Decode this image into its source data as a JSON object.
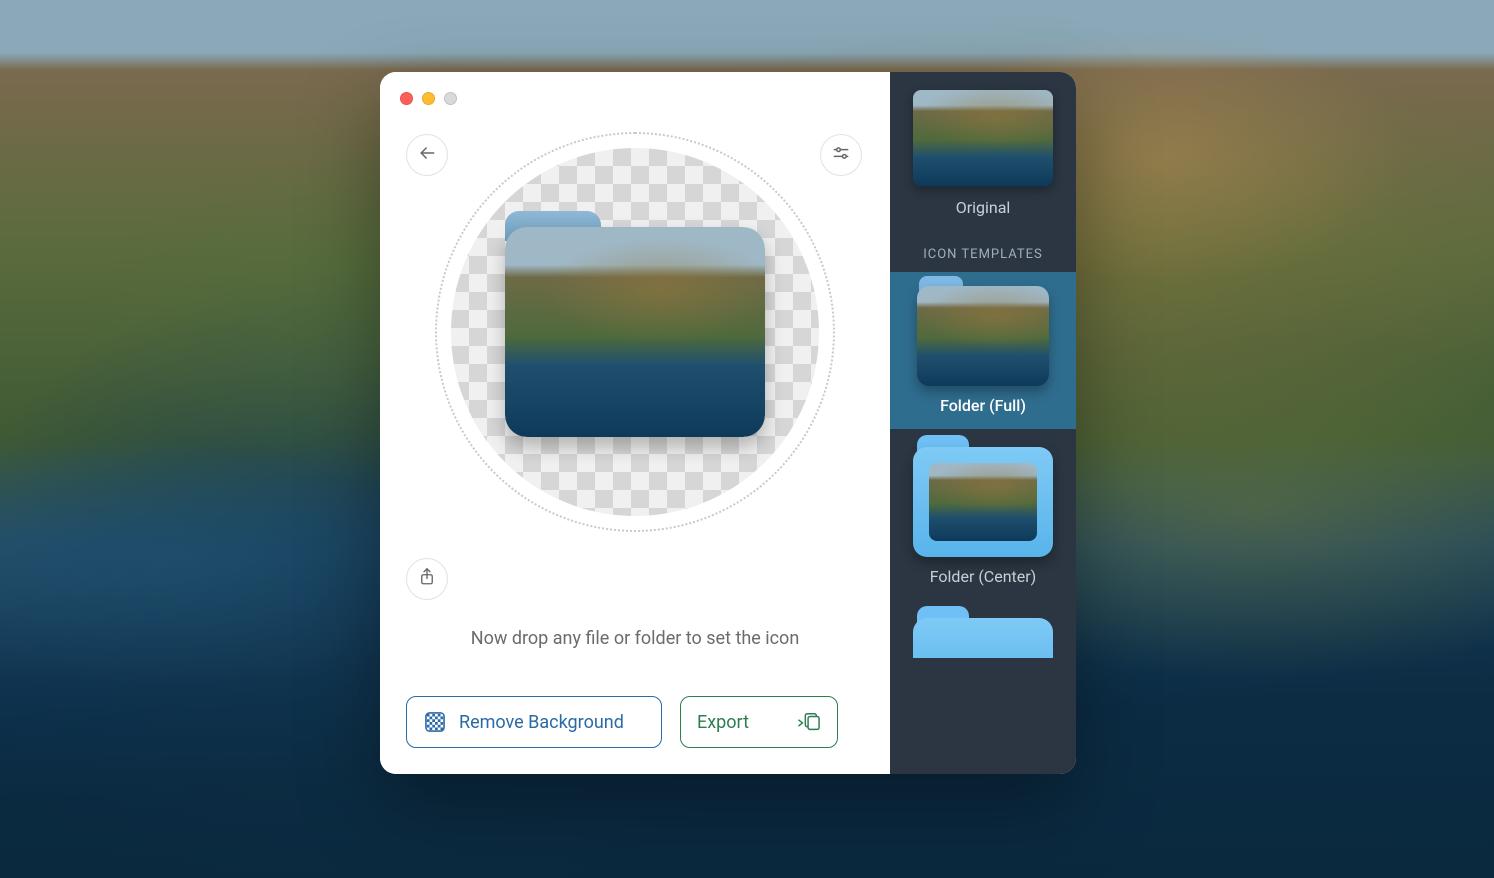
{
  "hint_text": "Now drop any file or folder to set the icon",
  "buttons": {
    "remove_bg": "Remove Background",
    "export": "Export"
  },
  "sidebar": {
    "original_label": "Original",
    "section_header": "ICON TEMPLATES",
    "templates": [
      {
        "label": "Folder (Full)",
        "selected": true
      },
      {
        "label": "Folder (Center)",
        "selected": false
      }
    ]
  },
  "icons": {
    "back": "back-arrow-icon",
    "settings": "sliders-icon",
    "share": "share-icon",
    "checker": "checker-background-icon",
    "export": "export-stack-icon"
  },
  "colors": {
    "blue": "#2a6aa5",
    "green": "#2e7d50",
    "sidebar_bg": "#2b3642",
    "selected_bg": "#2f6d8f"
  }
}
